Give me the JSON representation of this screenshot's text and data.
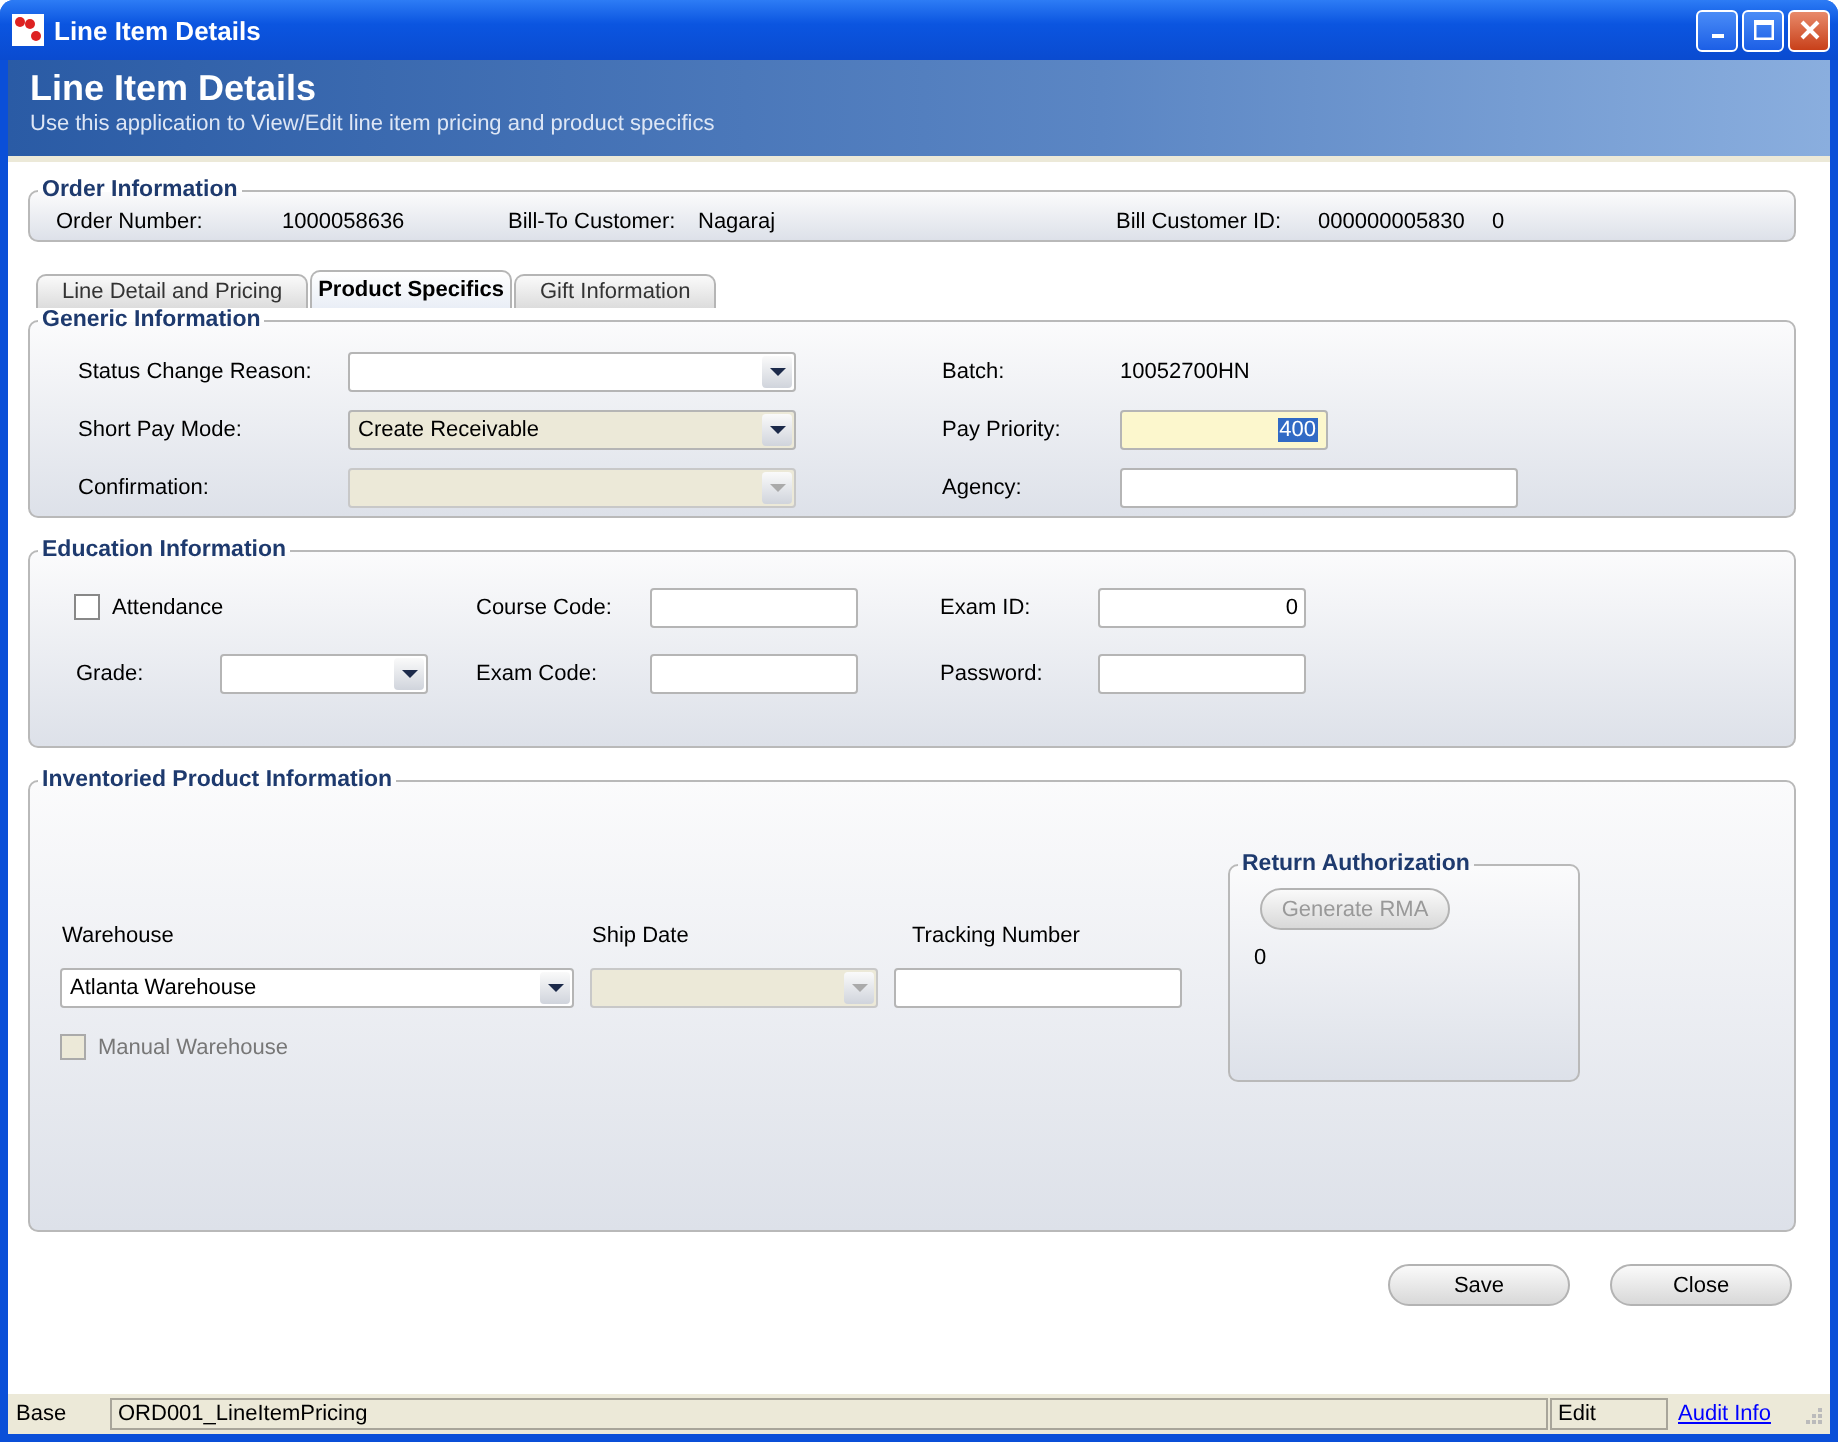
{
  "window": {
    "title": "Line Item Details"
  },
  "header": {
    "title": "Line Item Details",
    "subtitle": "Use this application to View/Edit line item pricing and product specifics"
  },
  "order_information": {
    "title": "Order Information",
    "items": [
      {
        "label": "Order Number:",
        "value": "1000058636"
      },
      {
        "label": "Bill-To Customer:",
        "value": "Nagaraj"
      },
      {
        "label": "Bill Customer ID:",
        "value": "000000005830",
        "extra": "0"
      }
    ]
  },
  "tabs": [
    {
      "label": "Line Detail and Pricing",
      "selected": false
    },
    {
      "label": "Product Specifics",
      "selected": true
    },
    {
      "label": "Gift Information",
      "selected": false
    }
  ],
  "generic_information": {
    "title": "Generic Information",
    "rows": [
      [
        {
          "label": "Status Change Reason:",
          "kind": "combo",
          "disabled": false,
          "readonly": false
        },
        {
          "label": "Batch:",
          "kind": "value",
          "value": "10052700HN"
        }
      ],
      [
        {
          "label": "Short Pay Mode:",
          "kind": "combo",
          "value": "Create Receivable",
          "disabled": false,
          "readonly": true
        },
        {
          "label": "Pay Priority:",
          "kind": "text",
          "value": "400",
          "focused": true
        }
      ],
      [
        {
          "label": "Confirmation:",
          "kind": "combo",
          "disabled": true,
          "readonly": true
        },
        {
          "label": "Agency:",
          "kind": "text",
          "focused": false
        }
      ]
    ]
  },
  "education_information": {
    "title": "Education Information",
    "attendance": {
      "label": "Attendance",
      "checked": false
    },
    "grade": {
      "label": "Grade:"
    },
    "fields": [
      {
        "label": "Course Code:"
      },
      {
        "label": "Exam ID:",
        "value": "0"
      },
      {
        "label": "Exam Code:"
      },
      {
        "label": "Password:"
      }
    ]
  },
  "inventoried_product_information": {
    "title": "Inventoried Product Information",
    "warehouse": {
      "label": "Warehouse",
      "value": "Atlanta Warehouse"
    },
    "ship_date": {
      "label": "Ship Date",
      "disabled": true
    },
    "tracking_number": {
      "label": "Tracking Number"
    },
    "manual_warehouse": {
      "label": "Manual Warehouse",
      "checked": false,
      "disabled": true
    },
    "return_authorization": {
      "title": "Return Authorization",
      "button": {
        "label": "Generate RMA",
        "disabled": true
      },
      "value": "0"
    }
  },
  "buttons": [
    "Save",
    "Close"
  ],
  "status_bar": {
    "mode": "Base",
    "form": "ORD001_LineItemPricing",
    "state": "Edit",
    "link": "Audit Info"
  }
}
